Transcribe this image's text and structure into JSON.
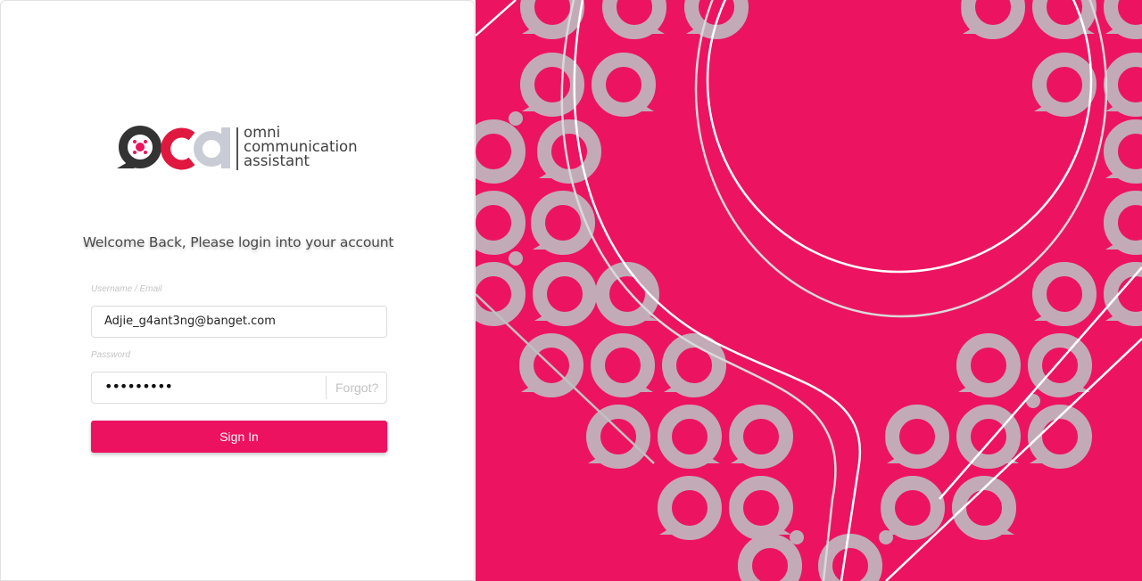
{
  "brand": {
    "logo_line1": "omni",
    "logo_line2": "communication",
    "logo_line3": "assistant",
    "primary_color": "#ed1260",
    "hero_color": "#ec1460"
  },
  "login": {
    "welcome": "Welcome Back, Please login into your account",
    "username_label": "Username / Email",
    "username_value": "Adjie_g4ant3ng@banget.com",
    "password_label": "Password",
    "password_value": "•••••••••",
    "forgot_label": "Forgot?",
    "signin_label": "Sign In"
  }
}
